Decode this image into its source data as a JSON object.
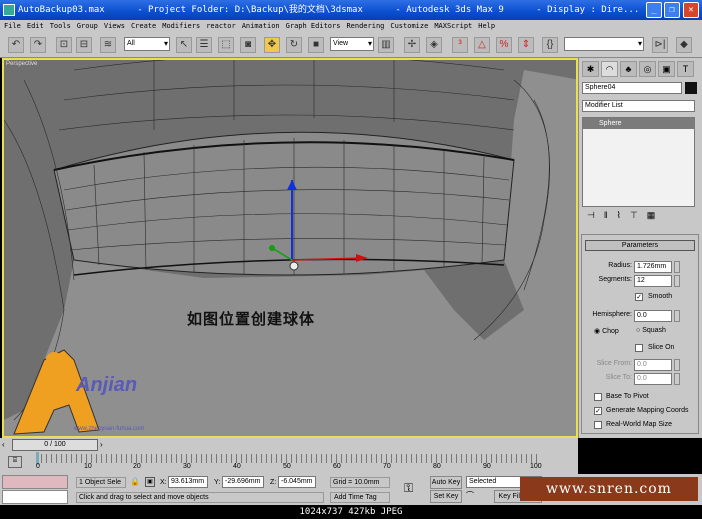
{
  "title": {
    "file": "AutoBackup03.max",
    "project": "- Project Folder: D:\\Backup\\我的文档\\3dsmax",
    "app": "- Autodesk 3ds Max 9",
    "display": "- Display : Dire..."
  },
  "menu": [
    "File",
    "Edit",
    "Tools",
    "Group",
    "Views",
    "Create",
    "Modifiers",
    "reactor",
    "Animation",
    "Graph Editors",
    "Rendering",
    "Customize",
    "MAXScript",
    "Help"
  ],
  "toolbar": {
    "filter": "All",
    "coord": "View"
  },
  "viewport": {
    "label": "Perspective",
    "caption": "如图位置创建球体",
    "logo": "Anjian",
    "logo_url": "www.zhenyuan-fuhua.com",
    "accent": "#e8e050"
  },
  "panel": {
    "object_name": "Sphere04",
    "modifier_list": "Modifier List",
    "stack_item": "Sphere",
    "rollout": "Parameters",
    "radius_label": "Radius:",
    "radius": "1.726mm",
    "segments_label": "Segments:",
    "segments": "12",
    "smooth": "Smooth",
    "hemisphere_label": "Hemisphere:",
    "hemisphere": "0.0",
    "chop": "Chop",
    "squash": "Squash",
    "slice_on": "Slice On",
    "slice_from_label": "Slice From:",
    "slice_from": "0.0",
    "slice_to_label": "Slice To:",
    "slice_to": "0.0",
    "base_to_pivot": "Base To Pivot",
    "gen_mapping": "Generate Mapping Coords",
    "real_world": "Real-World Map Size"
  },
  "timeline": {
    "frame": "0 / 100",
    "ticks": [
      "0",
      "10",
      "20",
      "30",
      "40",
      "50",
      "60",
      "70",
      "80",
      "90",
      "100"
    ]
  },
  "status": {
    "selection": "1 Object Sele",
    "x_label": "X:",
    "x": "93.613mm",
    "y_label": "Y:",
    "y": "-29.696mm",
    "z_label": "Z:",
    "z": "-6.045mm",
    "grid": "Grid = 10.0mm",
    "prompt": "Click and drag to select and move objects",
    "add_time_tag": "Add Time Tag",
    "auto_key": "Auto Key",
    "set_key": "Set Key",
    "key_mode": "Selected",
    "key_filters": "Key Filters..."
  },
  "watermark": "www.snren.com",
  "footer": "1024x737  427kb  JPEG"
}
